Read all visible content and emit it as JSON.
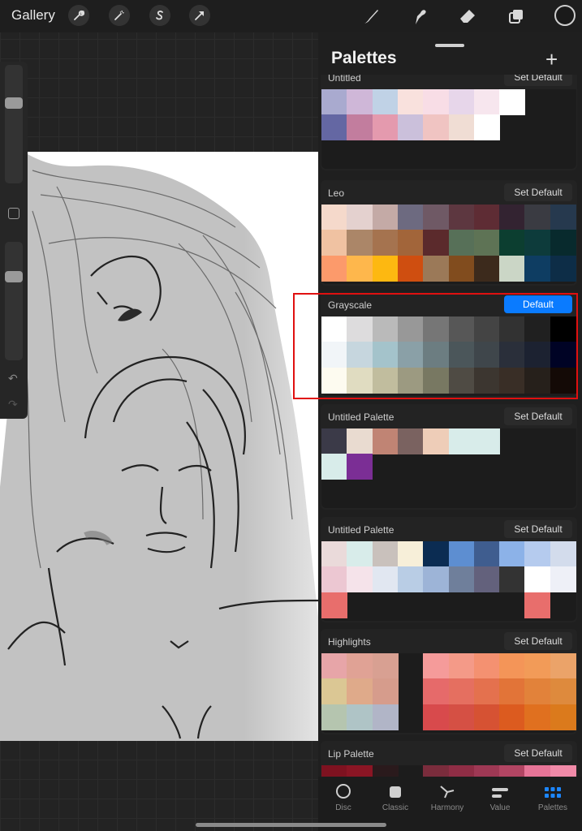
{
  "topbar": {
    "gallery_label": "Gallery",
    "left_icons": [
      "wrench-icon",
      "magic-wand-icon",
      "selection-s-icon",
      "arrow-transform-icon"
    ],
    "right_icons": [
      "brush-icon",
      "smudge-icon",
      "eraser-icon",
      "layers-icon"
    ],
    "current_color": "#1a1a1a"
  },
  "panel": {
    "title": "Palettes",
    "add_label": "+",
    "set_default_label": "Set Default",
    "default_label": "Default"
  },
  "palettes": [
    {
      "name": "Untitled",
      "is_default": false,
      "rows": [
        [
          "#a9aacf",
          "#cfb7d8",
          "#c0d2e6",
          "#f9e1dd",
          "#f8dde6",
          "#e7d6ea",
          "#f7e6ee",
          "#ffffff"
        ],
        [
          "#6467a3",
          "#c27d9e",
          "#e49aae",
          "#cbc0db",
          "#f0c4c2",
          "#f0ddd4",
          "#ffffff"
        ]
      ]
    },
    {
      "name": "Leo",
      "is_default": false,
      "rows": [
        [
          "#f5d9cb",
          "#e4d1cf",
          "#c4aaa6",
          "#6d6a80",
          "#6f5965",
          "#5d3740",
          "#5e2c34",
          "#332331",
          "#3a3b42",
          "#26394e"
        ],
        [
          "#f0c2a2",
          "#ab8668",
          "#a5734f",
          "#a2653a",
          "#5b2a2c",
          "#577058",
          "#5e7355",
          "#0c3e30",
          "#0d3b3b",
          "#082a2d"
        ],
        [
          "#fc9a6b",
          "#feb74c",
          "#fdb811",
          "#cf4e10",
          "#9b7958",
          "#814c1e",
          "#3c2a1c",
          "#cbd6c6",
          "#0e3d62",
          "#0d2d47"
        ]
      ]
    },
    {
      "name": "Grayscale",
      "is_default": true,
      "rows": [
        [
          "#ffffff",
          "#dddcdd",
          "#bababa",
          "#989898",
          "#767676",
          "#575757",
          "#444444",
          "#323232",
          "#202020",
          "#000000"
        ],
        [
          "#f1f5f8",
          "#c6d6de",
          "#a4c3cb",
          "#8aa0a7",
          "#6c7d81",
          "#4b565a",
          "#3f464b",
          "#2a2f3a",
          "#1c2231",
          "#000325"
        ],
        [
          "#fdfbf0",
          "#e0dcc1",
          "#c1bd9e",
          "#9c9a81",
          "#787862",
          "#4f4b44",
          "#3c3630",
          "#392e26",
          "#26201b",
          "#140a06"
        ]
      ]
    },
    {
      "name": "Untitled Palette",
      "is_default": false,
      "rows": [
        [
          "#3b3a48",
          "#e9dbd0",
          "#c08474",
          "#7a6260",
          "#eecdb8",
          "#d8ecea",
          "#d8ecea"
        ],
        [
          "#d8ecea",
          "#7b2e95"
        ]
      ]
    },
    {
      "name": "Untitled Palette",
      "is_default": false,
      "rows": [
        [
          "#eadada",
          "#d8ecea",
          "#c9c1bc",
          "#f7efd9",
          "#0b2c52",
          "#5d8ed1",
          "#3f5d8f",
          "#8cb2e8",
          "#b5cbee",
          "#d3dcec"
        ],
        [
          "#ecc7d2",
          "#f5e3ea",
          "#e1e7f1",
          "#b9cde5",
          "#9db4d7",
          "#6f7f9b",
          "#63617c",
          "#333333",
          "#ffffff",
          "#eef0f7"
        ],
        [
          "#e86e6c",
          "",
          "",
          "",
          "",
          "",
          "",
          "",
          "#e86e6c",
          ""
        ]
      ]
    },
    {
      "name": "Highlights",
      "is_default": false,
      "rows": [
        [
          "#e7a5a8",
          "#e0a295",
          "#d8a092",
          "",
          "#f59b9a",
          "#f49a88",
          "#f49171",
          "#f49558",
          "#f29b58",
          "#eba369"
        ],
        [
          "#dbc794",
          "#dfaa8a",
          "#d69c8c",
          "",
          "#e66a6a",
          "#e56f60",
          "#e4714e",
          "#e27438",
          "#e2823a",
          "#de8a3d"
        ],
        [
          "#b5c5af",
          "#afc4c6",
          "#b1b5c7",
          "",
          "#d84a4c",
          "#d55044",
          "#d65233",
          "#dc5b1f",
          "#e0701f",
          "#db7a1c"
        ]
      ]
    },
    {
      "name": "Lip Palette",
      "is_default": false,
      "rows": [
        [
          "#7e1220",
          "#8a1524",
          "#2a1a1c",
          "",
          "#7a2c3c",
          "#8f2d45",
          "#9e3854",
          "#b24563",
          "#e67497",
          "#f18aa8"
        ]
      ]
    }
  ],
  "tabs": [
    {
      "label": "Disc",
      "active": false
    },
    {
      "label": "Classic",
      "active": false
    },
    {
      "label": "Harmony",
      "active": false
    },
    {
      "label": "Value",
      "active": false
    },
    {
      "label": "Palettes",
      "active": true
    }
  ]
}
